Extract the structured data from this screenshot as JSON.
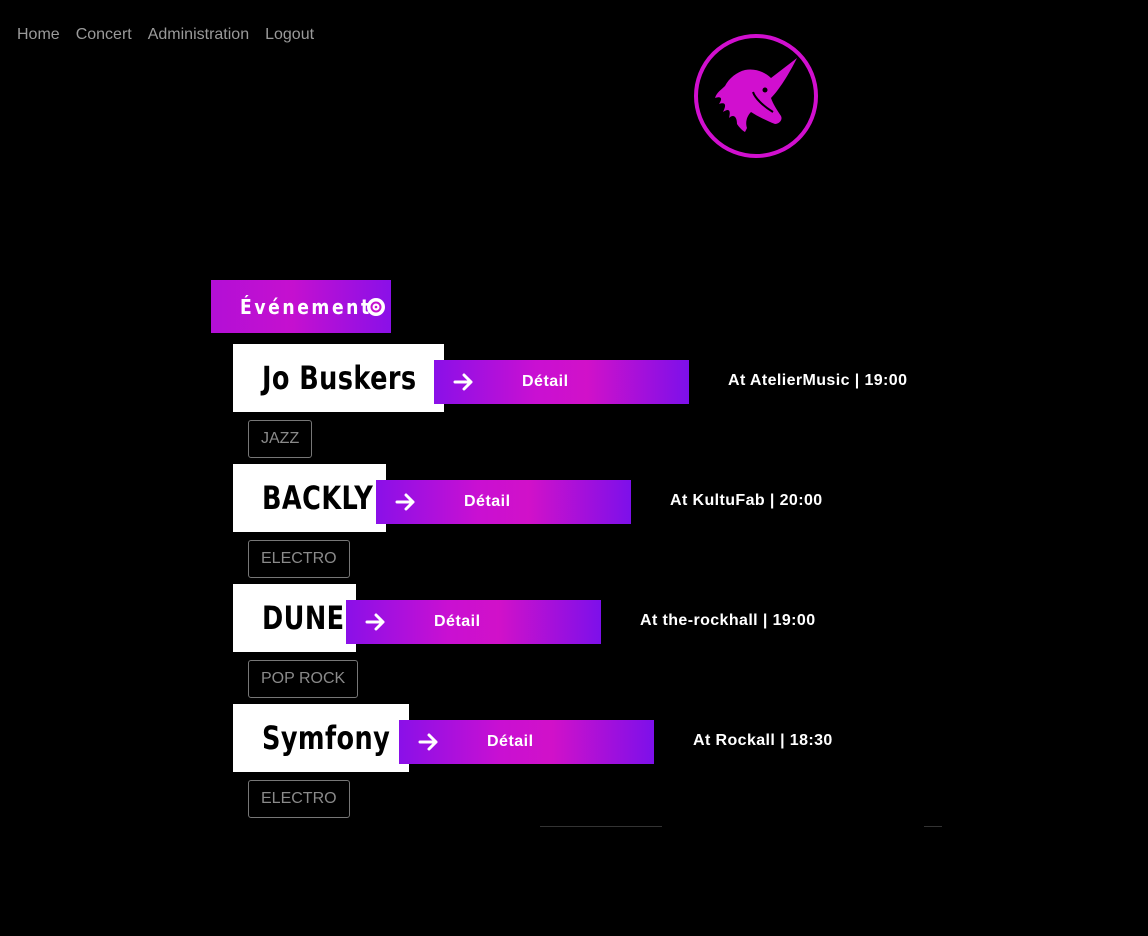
{
  "nav": {
    "items": [
      {
        "label": "Home"
      },
      {
        "label": "Concert"
      },
      {
        "label": "Administration"
      },
      {
        "label": "Logout"
      }
    ]
  },
  "logo": {
    "icon": "unicorn-icon",
    "color": "#d10fcf"
  },
  "section": {
    "title": "Événements",
    "icon": "disc-icon"
  },
  "events": [
    {
      "name": "Jo Buskers",
      "detail_label": "Détail",
      "venue": "At AtelierMusic | 19:00",
      "tag": "JAZZ"
    },
    {
      "name": "BACKLY",
      "detail_label": "Détail",
      "venue": "At KultuFab | 20:00",
      "tag": "ELECTRO"
    },
    {
      "name": "DUNE",
      "detail_label": "Détail",
      "venue": "At the-rockhall | 19:00",
      "tag": "POP ROCK"
    },
    {
      "name": "Symfony",
      "detail_label": "Détail",
      "venue": "At Rockall | 18:30",
      "tag": "ELECTRO"
    }
  ],
  "colors": {
    "background": "#000000",
    "accent_magenta": "#c910d2",
    "accent_violet": "#8a10e8",
    "nav_text": "#9a9a9a"
  }
}
